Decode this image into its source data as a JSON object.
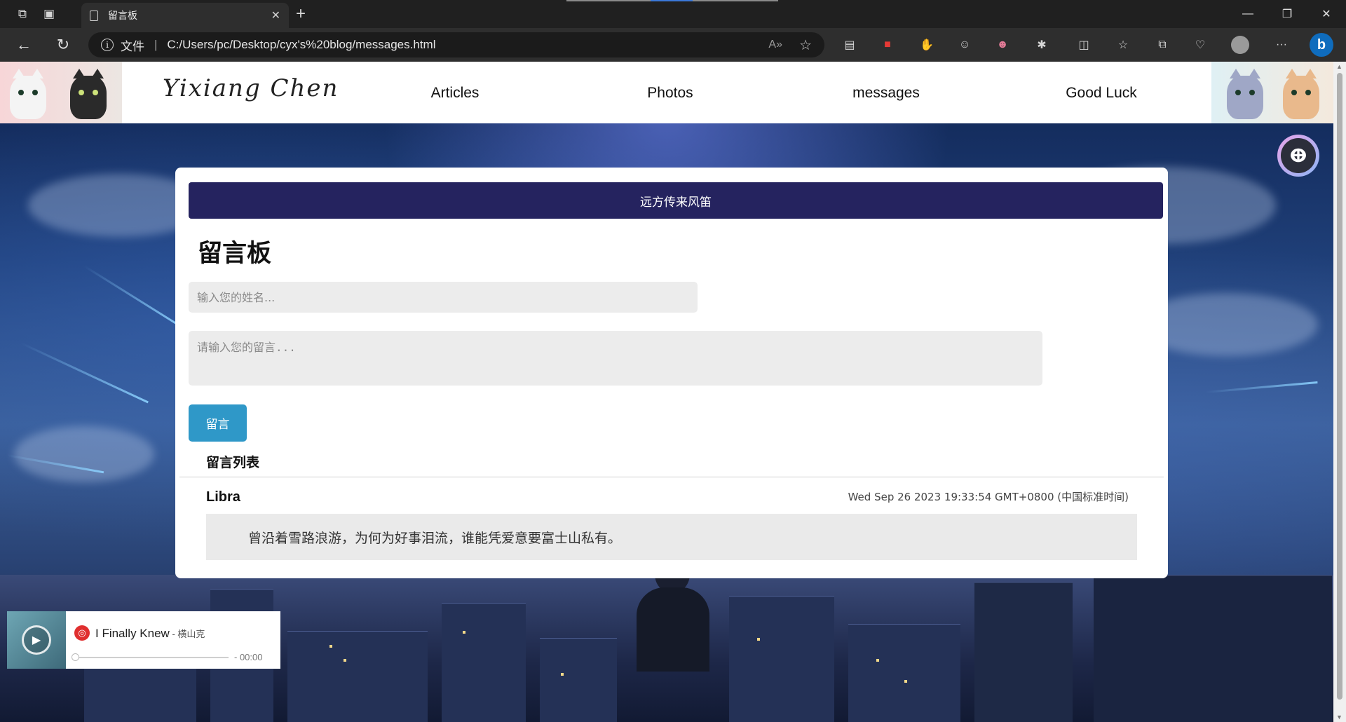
{
  "browser": {
    "tab_title": "留言板",
    "address_scheme_label": "文件",
    "url": "C:/Users/pc/Desktop/cyx's%20blog/messages.html"
  },
  "site": {
    "brand": "Yixiang Chen",
    "nav": [
      {
        "label": "Articles"
      },
      {
        "label": "Photos"
      },
      {
        "label": "messages"
      },
      {
        "label": "Good Luck"
      }
    ]
  },
  "board": {
    "banner": "远方传来风笛",
    "title": "留言板",
    "name_placeholder": "输入您的姓名...",
    "message_placeholder": "请输入您的留言...",
    "submit_label": "留言",
    "list_title": "留言列表",
    "messages": [
      {
        "author": "Libra",
        "timestamp": "Wed Sep 26 2023 19:33:54 GMT+0800 (中国标准时间)",
        "content": "曾沿着雪路浪游，为何为好事泪流，谁能凭爱意要富士山私有。"
      }
    ]
  },
  "player": {
    "song": "I Finally Knew",
    "artist": " - 横山克",
    "time": "- 00:00"
  },
  "colors": {
    "banner_bg": "#25235f",
    "submit_bg": "#2f98c8",
    "input_bg": "#ececec"
  }
}
